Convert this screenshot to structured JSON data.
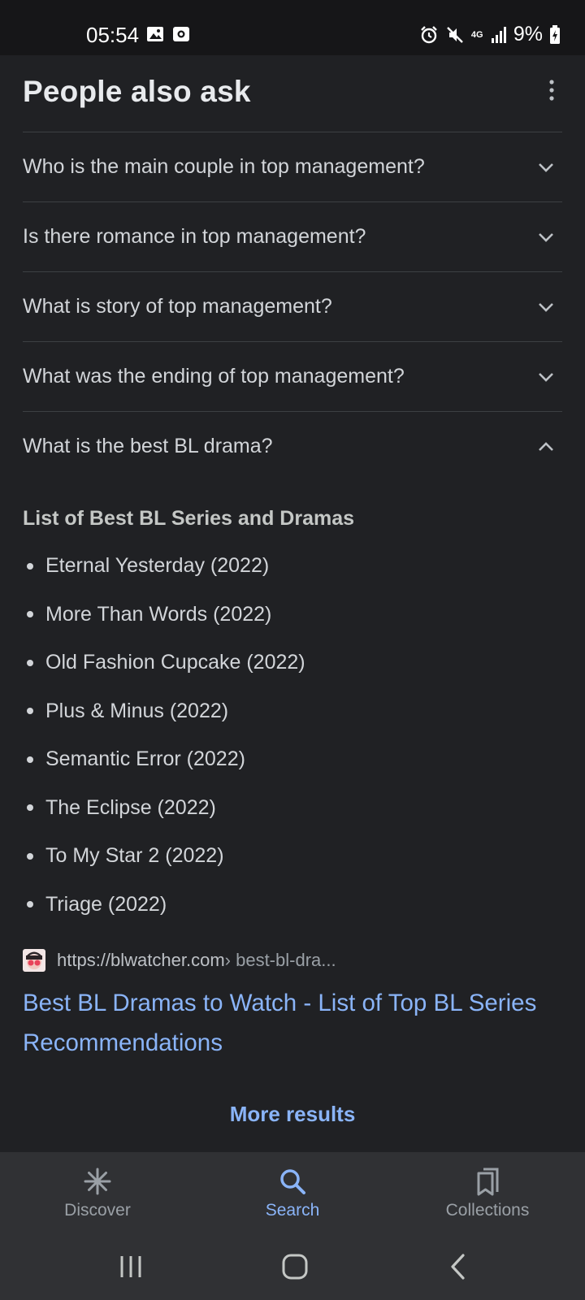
{
  "status_bar": {
    "time": "05:54",
    "network": "4G",
    "battery": "9%",
    "icons": [
      "image-icon",
      "screenshot-icon",
      "alarm-icon",
      "mute-icon",
      "signal-icon",
      "battery-charging-icon"
    ]
  },
  "paa": {
    "title": "People also ask",
    "questions": [
      {
        "text": "Who is the main couple in top management?",
        "expanded": false
      },
      {
        "text": "Is there romance in top management?",
        "expanded": false
      },
      {
        "text": "What is story of top management?",
        "expanded": false
      },
      {
        "text": "What was the ending of top management?",
        "expanded": false
      },
      {
        "text": "What is the best BL drama?",
        "expanded": true
      }
    ]
  },
  "answer": {
    "heading": "List of Best BL Series and Dramas",
    "items": [
      "Eternal Yesterday (2022)",
      "More Than Words (2022)",
      "Old Fashion Cupcake (2022)",
      "Plus & Minus (2022)",
      "Semantic Error (2022)",
      "The Eclipse (2022)",
      "To My Star 2 (2022)",
      "Triage (2022)"
    ],
    "source_url": "https://blwatcher.com",
    "source_path": " › best-bl-dra...",
    "result_title": "Best BL Dramas to Watch - List of Top BL Series Recommendations"
  },
  "more_results": "More results",
  "bottom_nav": {
    "tabs": [
      {
        "label": "Discover",
        "icon": "discover-icon",
        "active": false
      },
      {
        "label": "Search",
        "icon": "search-icon",
        "active": true
      },
      {
        "label": "Collections",
        "icon": "collections-icon",
        "active": false
      }
    ]
  },
  "colors": {
    "background": "#202124",
    "link": "#8ab4f8",
    "text": "#d2d5d9",
    "nav_bg": "#303134"
  }
}
